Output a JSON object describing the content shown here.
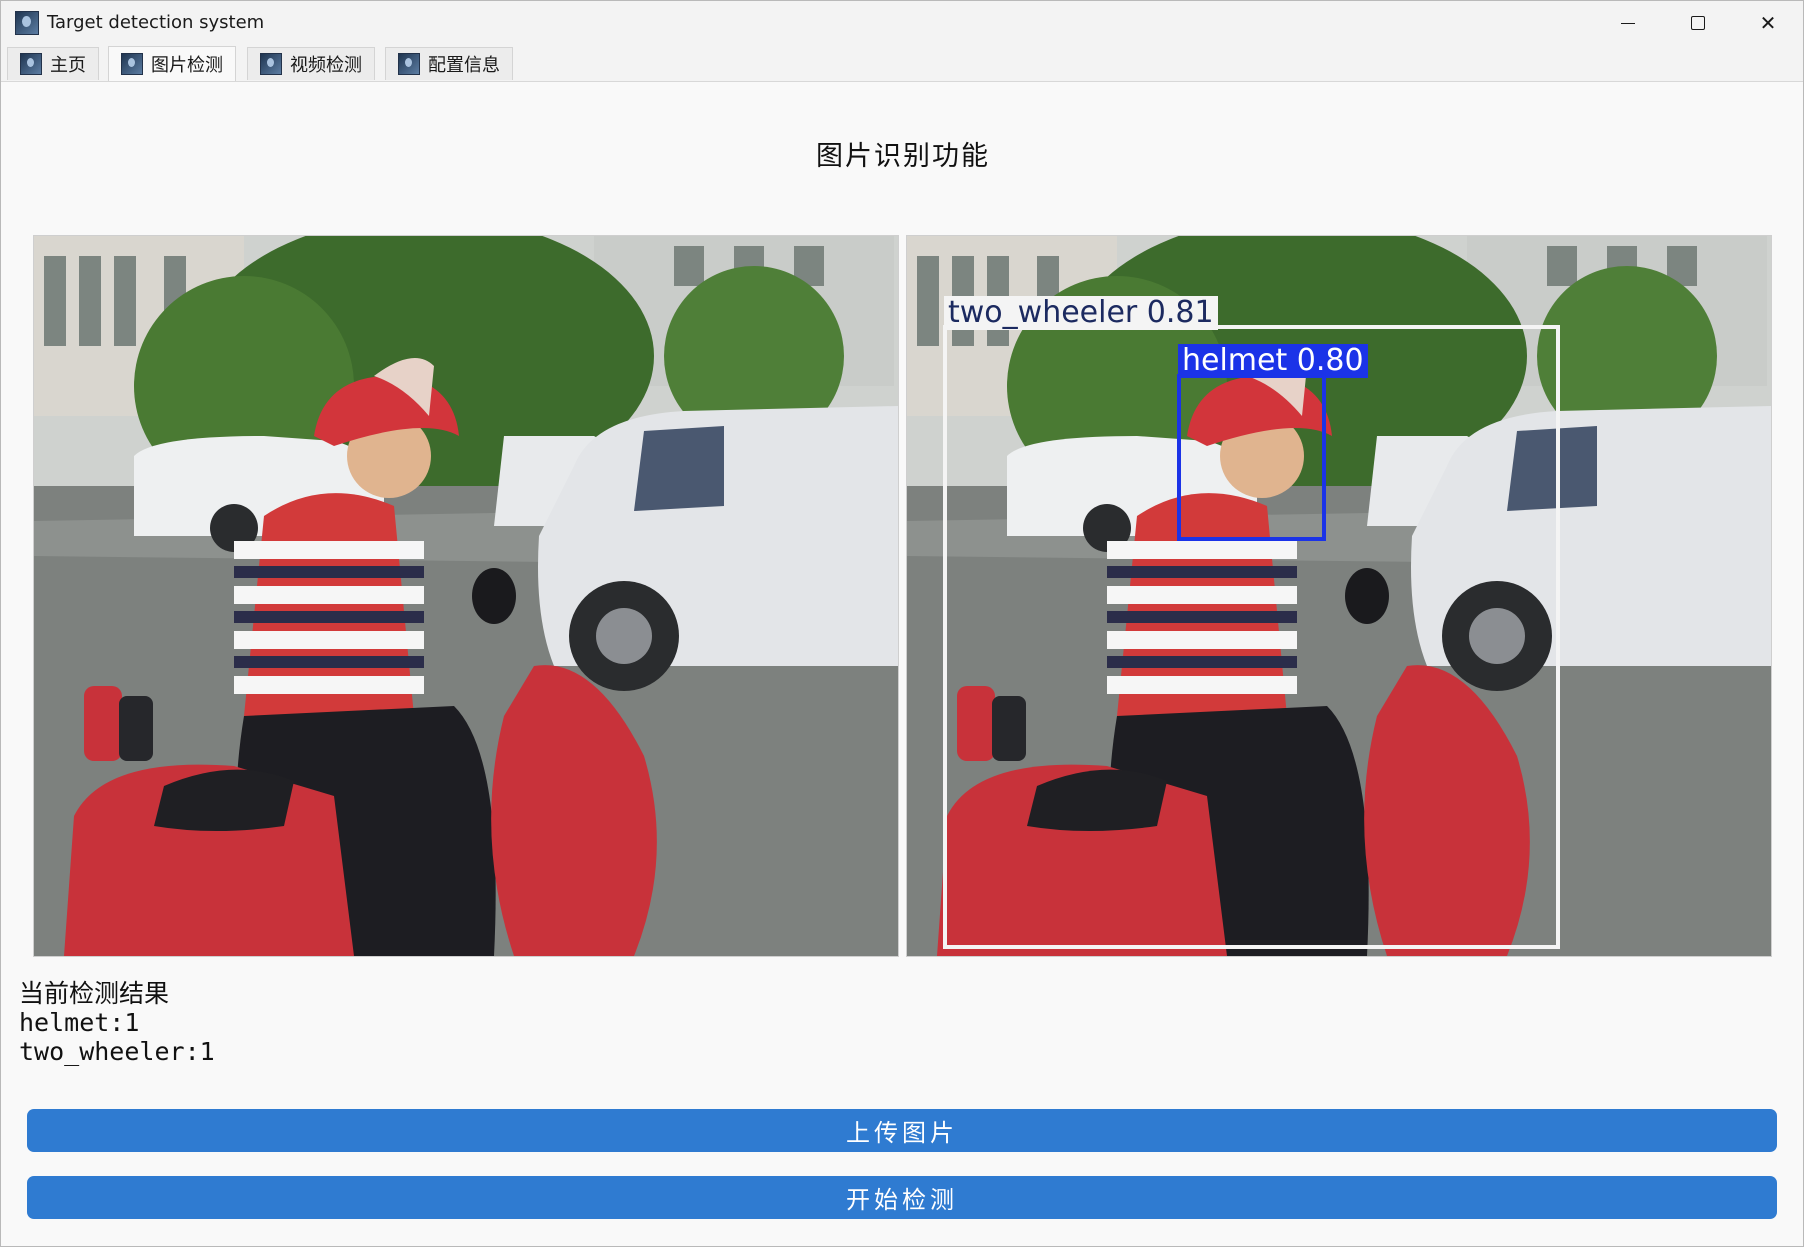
{
  "window": {
    "title": "Target detection system"
  },
  "tabs": [
    {
      "label": "主页"
    },
    {
      "label": "图片检测"
    },
    {
      "label": "视频检测"
    },
    {
      "label": "配置信息"
    }
  ],
  "main": {
    "heading": "图片识别功能",
    "detections": [
      {
        "label": "two_wheeler 0.81",
        "color": "#f4f4f4"
      },
      {
        "label": "helmet 0.80",
        "color": "#1b33e8"
      }
    ],
    "results": {
      "title": "当前检测结果",
      "lines": [
        "helmet:1",
        "two_wheeler:1"
      ]
    },
    "buttons": {
      "upload": "上传图片",
      "start": "开始检测"
    }
  },
  "colors": {
    "accent": "#2f7bd1",
    "background": "#f9f9f9"
  }
}
